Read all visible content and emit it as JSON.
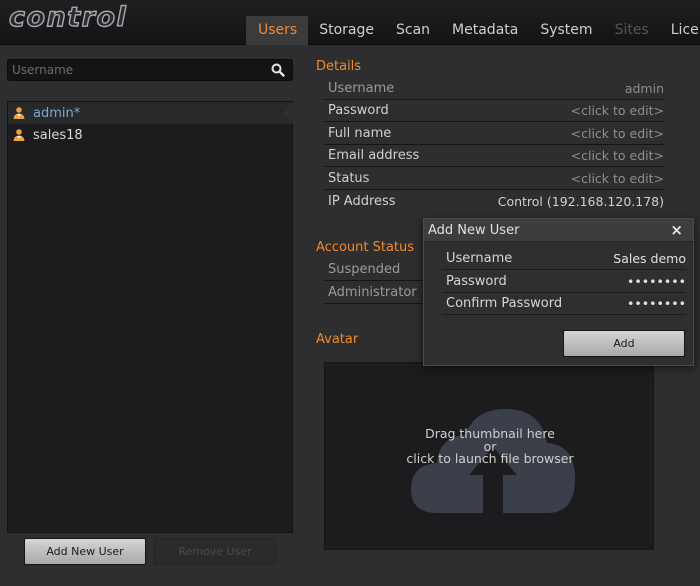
{
  "app": {
    "logo": "control"
  },
  "tabs": [
    {
      "label": "Users",
      "active": true
    },
    {
      "label": "Storage"
    },
    {
      "label": "Scan"
    },
    {
      "label": "Metadata"
    },
    {
      "label": "System"
    },
    {
      "label": "Sites",
      "disabled": true
    },
    {
      "label": "Licence"
    }
  ],
  "search": {
    "placeholder": "Username",
    "icon": "search-icon"
  },
  "users": [
    {
      "name": "admin*",
      "selected": true,
      "icon": "user-icon"
    },
    {
      "name": "sales18",
      "icon": "user-icon"
    }
  ],
  "buttons": {
    "add_user": "Add New User",
    "remove_user": "Remove User"
  },
  "details": {
    "title": "Details",
    "rows": [
      {
        "label": "Username",
        "value": "admin"
      },
      {
        "label": "Password",
        "value": "<click to edit>"
      },
      {
        "label": "Full name",
        "value": "<click to edit>"
      },
      {
        "label": "Email address",
        "value": "<click to edit>"
      },
      {
        "label": "Status",
        "value": "<click to edit>"
      },
      {
        "label": "IP Address",
        "value": "Control (192.168.120.178)"
      }
    ]
  },
  "account_status": {
    "title": "Account Status",
    "rows": [
      {
        "label": "Suspended"
      },
      {
        "label": "Administrator"
      }
    ]
  },
  "avatar": {
    "title": "Avatar",
    "line1": "Drag thumbnail here",
    "line2": "or",
    "line3": "click to launch file browser",
    "icon": "cloud-upload-icon"
  },
  "modal": {
    "title": "Add New User",
    "close": "×",
    "rows": [
      {
        "label": "Username",
        "value": "Sales demo"
      },
      {
        "label": "Password",
        "value": "••••••••"
      },
      {
        "label": "Confirm Password",
        "value": "••••••••"
      }
    ],
    "add_button": "Add"
  },
  "colors": {
    "accent": "#f08a2a",
    "selected_user": "#7ea7d8",
    "background": "#2e2e30"
  }
}
